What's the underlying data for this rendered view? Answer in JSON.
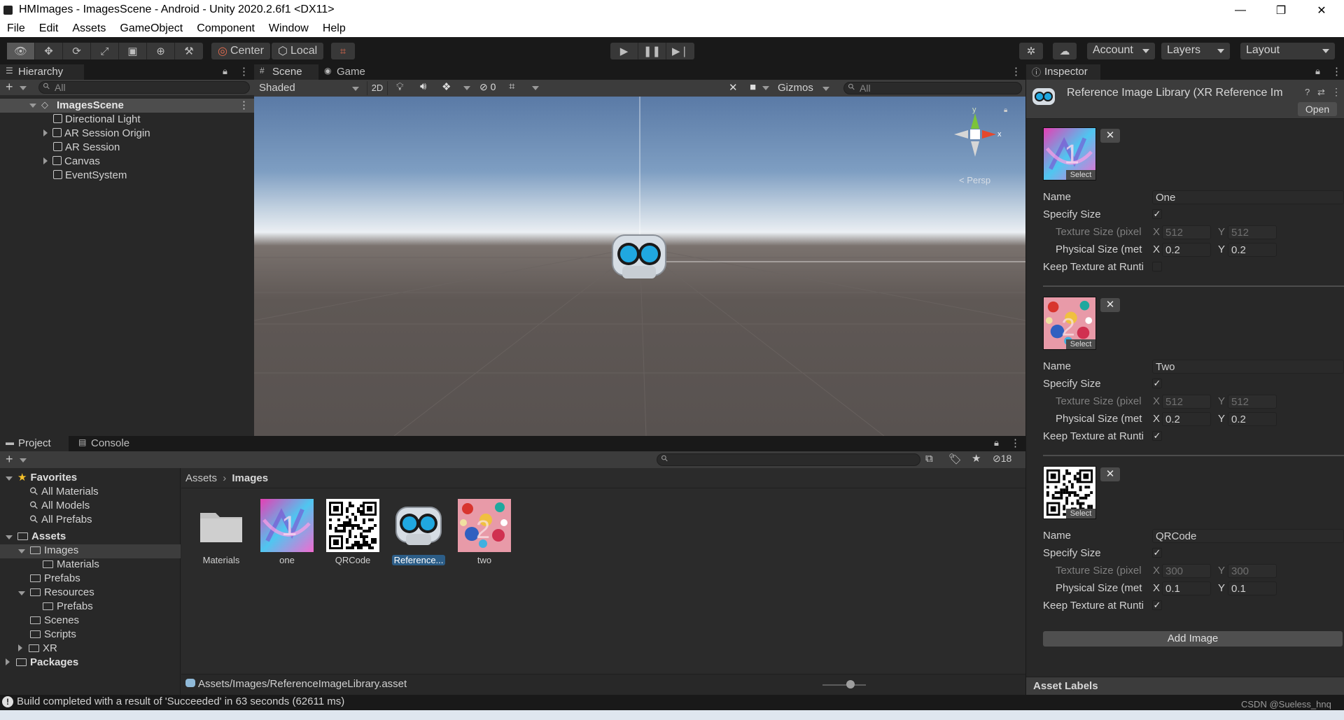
{
  "window": {
    "title": "HMImages - ImagesScene - Android - Unity 2020.2.6f1 <DX11>",
    "minimize": "—",
    "maximize": "❐",
    "close": "✕"
  },
  "menu": [
    "File",
    "Edit",
    "Assets",
    "GameObject",
    "Component",
    "Window",
    "Help"
  ],
  "toolbar": {
    "pivot": "Center",
    "space": "Local",
    "account": "Account",
    "layers": "Layers",
    "layout": "Layout"
  },
  "hierarchy": {
    "tab": "Hierarchy",
    "search_placeholder": "All",
    "scene": "ImagesScene",
    "items": [
      {
        "label": "Directional Light",
        "expandable": false
      },
      {
        "label": "AR Session Origin",
        "expandable": true
      },
      {
        "label": "AR Session",
        "expandable": false
      },
      {
        "label": "Canvas",
        "expandable": true
      },
      {
        "label": "EventSystem",
        "expandable": false
      }
    ]
  },
  "scene_view": {
    "tabs": [
      "Scene",
      "Game"
    ],
    "shading": "Shaded",
    "mode_2d": "2D",
    "hidden_count": "0",
    "gizmos": "Gizmos",
    "search_placeholder": "All",
    "axis_y": "y",
    "axis_x": "x",
    "projection": "< Persp"
  },
  "project": {
    "tabs": [
      "Project",
      "Console"
    ],
    "hidden_count": "18",
    "breadcrumb": [
      "Assets",
      "Images"
    ],
    "tree": [
      {
        "label": "Favorites",
        "indent": 0,
        "bold": true,
        "kind": "star"
      },
      {
        "label": "All Materials",
        "indent": 1,
        "kind": "search"
      },
      {
        "label": "All Models",
        "indent": 1,
        "kind": "search"
      },
      {
        "label": "All Prefabs",
        "indent": 1,
        "kind": "search"
      },
      {
        "label": "Assets",
        "indent": 0,
        "bold": true,
        "kind": "folder"
      },
      {
        "label": "Images",
        "indent": 1,
        "kind": "folder",
        "selected": true
      },
      {
        "label": "Materials",
        "indent": 2,
        "kind": "folder"
      },
      {
        "label": "Prefabs",
        "indent": 1,
        "kind": "folder"
      },
      {
        "label": "Resources",
        "indent": 1,
        "kind": "folder"
      },
      {
        "label": "Prefabs",
        "indent": 2,
        "kind": "folder"
      },
      {
        "label": "Scenes",
        "indent": 1,
        "kind": "folder"
      },
      {
        "label": "Scripts",
        "indent": 1,
        "kind": "folder"
      },
      {
        "label": "XR",
        "indent": 1,
        "kind": "folder"
      },
      {
        "label": "Packages",
        "indent": 0,
        "bold": true,
        "kind": "folder"
      }
    ],
    "assets": [
      {
        "label": "Materials",
        "kind": "folder"
      },
      {
        "label": "one",
        "kind": "img1"
      },
      {
        "label": "QRCode",
        "kind": "qr"
      },
      {
        "label": "Reference...",
        "kind": "ref",
        "selected": true
      },
      {
        "label": "two",
        "kind": "img2"
      }
    ],
    "footer_path": "Assets/Images/ReferenceImageLibrary.asset"
  },
  "inspector": {
    "tab": "Inspector",
    "header_title": "Reference Image Library (XR Reference Im",
    "open_button": "Open",
    "select_label": "Select",
    "labels": {
      "name": "Name",
      "specify_size": "Specify Size",
      "texture_size": "Texture Size (pixel",
      "physical_size": "Physical Size (met",
      "keep_texture": "Keep Texture at Runti",
      "x": "X",
      "y": "Y"
    },
    "images": [
      {
        "name": "One",
        "specify": true,
        "tex_x": "512",
        "tex_y": "512",
        "phys_x": "0.2",
        "phys_y": "0.2",
        "keep": false,
        "thumb": "img1"
      },
      {
        "name": "Two",
        "specify": true,
        "tex_x": "512",
        "tex_y": "512",
        "phys_x": "0.2",
        "phys_y": "0.2",
        "keep": true,
        "thumb": "img2"
      },
      {
        "name": "QRCode",
        "specify": true,
        "tex_x": "300",
        "tex_y": "300",
        "phys_x": "0.1",
        "phys_y": "0.1",
        "keep": true,
        "thumb": "qr"
      }
    ],
    "add_image": "Add Image",
    "asset_labels": "Asset Labels"
  },
  "status": {
    "message": "Build completed with a result of 'Succeeded' in 63 seconds (62611 ms)",
    "watermark": "CSDN @Sueless_hnq"
  },
  "colors": {
    "accent_selection": "#2c5d87",
    "panel_bg": "#282828",
    "play_icon": "#c8c8c8"
  }
}
